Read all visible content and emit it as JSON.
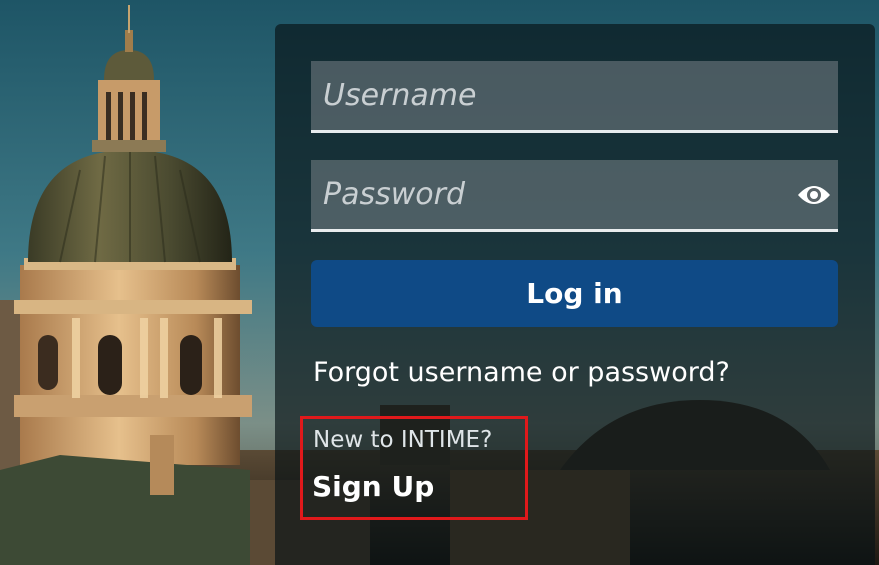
{
  "login": {
    "username_placeholder": "Username",
    "password_placeholder": "Password",
    "login_label": "Log in",
    "forgot_label": "Forgot username or password?",
    "new_user_text": "New to INTIME?",
    "signup_label": "Sign Up"
  },
  "icons": {
    "password_toggle": "eye-icon"
  },
  "colors": {
    "login_button": "#0f4a86",
    "highlight_box": "#e0191b"
  }
}
